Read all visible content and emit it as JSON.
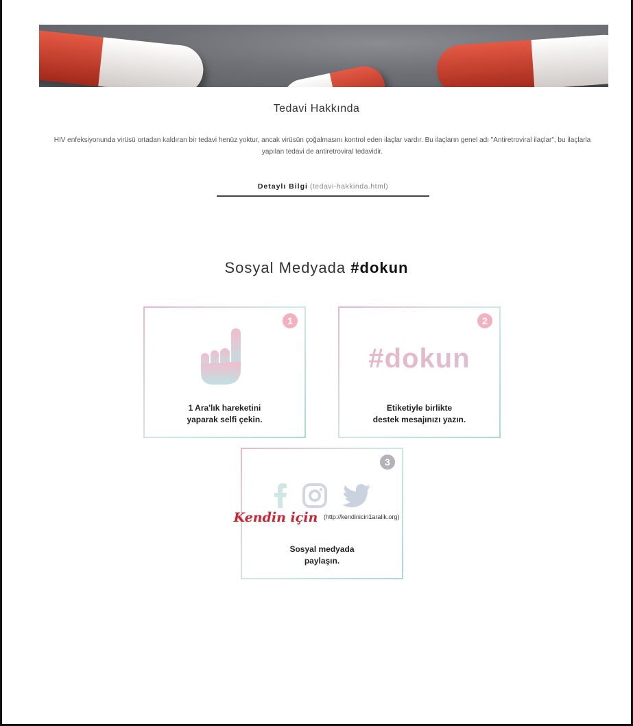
{
  "treatment": {
    "title": "Tedavi Hakkında",
    "description": "HIV enfeksiyonunda virüsü ortadan kaldıran bir tedavi henüz yoktur, ancak virüsün çoğalmasını kontrol eden ilaçlar vardır. Bu ilaçların genel adı \"Antiretroviral ilaçlar\", bu ilaçlarla yapılan tedavi de antiretroviral tedavidir.",
    "link_label": "Detaylı Bilgi",
    "link_href": "(tedavi-hakkinda.html)"
  },
  "social": {
    "heading_prefix": "Sosyal Medyada",
    "heading_tag": "#dokun",
    "cards": [
      {
        "number": "1",
        "line1": "1 Ara'lık hareketini",
        "line2": "yaparak selfi çekin.",
        "icon": "hand-icon"
      },
      {
        "number": "2",
        "tag": "#dokun",
        "line1": "Etiketiyle birlikte",
        "line2": "destek mesajınızı yazın.",
        "icon": "hashtag"
      },
      {
        "number": "3",
        "line1": "Sosyal medyada",
        "line2": "paylaşın.",
        "icons": [
          "facebook-icon",
          "instagram-icon",
          "twitter-icon"
        ]
      }
    ]
  },
  "footer": {
    "brand": "Kendin için",
    "url": "(http://kendinicin1aralik.org)"
  },
  "colors": {
    "brand_red": "#d41f2e",
    "badge_pink": "#f2b1bf",
    "badge_gray": "#b4b1b9"
  }
}
